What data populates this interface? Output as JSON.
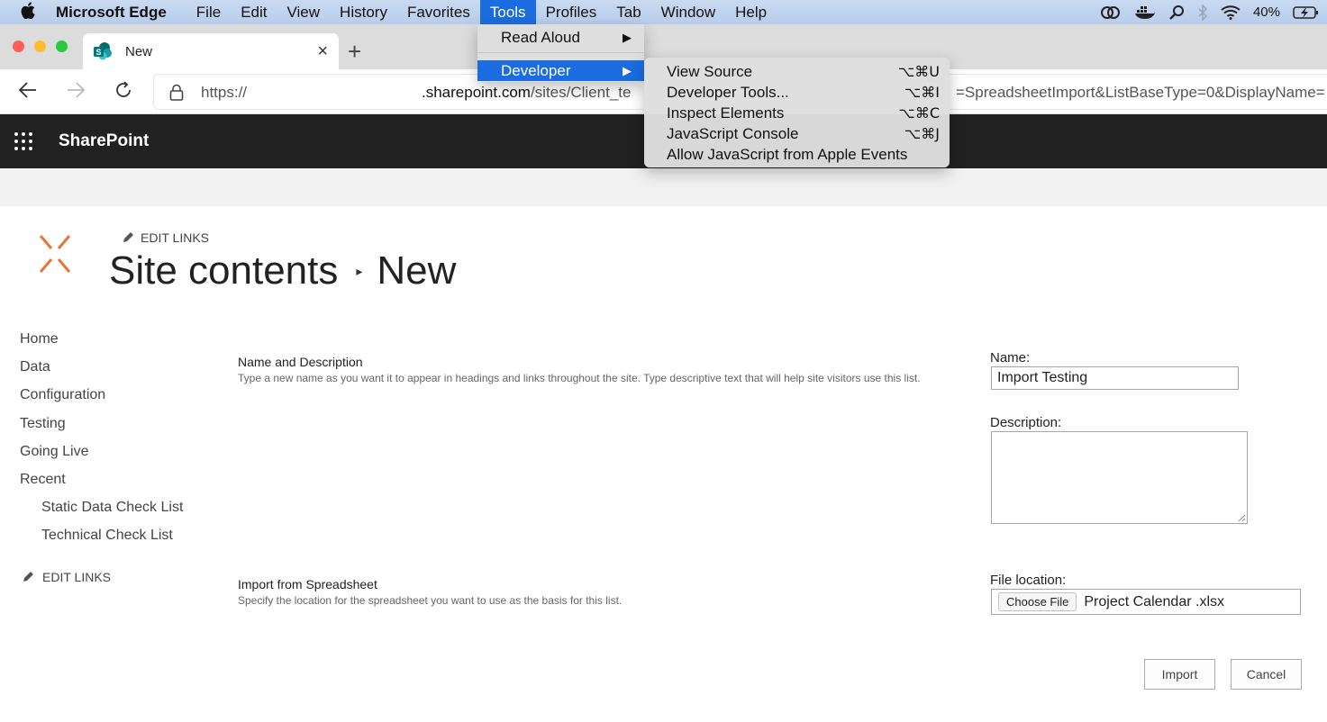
{
  "menubar": {
    "app_name": "Microsoft Edge",
    "items": [
      "File",
      "Edit",
      "View",
      "History",
      "Favorites",
      "Tools",
      "Profiles",
      "Tab",
      "Window",
      "Help"
    ],
    "active_item": "Tools",
    "battery": "40%"
  },
  "tools_menu": {
    "items": [
      {
        "label": "Read Aloud",
        "submenu": true
      },
      {
        "label": "Developer",
        "submenu": true,
        "highlighted": true
      }
    ]
  },
  "developer_menu": {
    "items": [
      {
        "label": "View Source",
        "shortcut": "⌥⌘U"
      },
      {
        "label": "Developer Tools...",
        "shortcut": "⌥⌘I"
      },
      {
        "label": "Inspect Elements",
        "shortcut": "⌥⌘C"
      },
      {
        "label": "JavaScript Console",
        "shortcut": "⌥⌘J"
      },
      {
        "label": "Allow JavaScript from Apple Events",
        "shortcut": ""
      }
    ]
  },
  "browser": {
    "tab_title": "New",
    "url_prefix": "https://",
    "url_domain": ".sharepoint.com",
    "url_path": "/sites/Client_te",
    "url_tail": "=SpreadsheetImport&ListBaseType=0&DisplayName="
  },
  "suite_bar": {
    "title": "SharePoint"
  },
  "page": {
    "edit_links": "EDIT LINKS",
    "breadcrumb_parent": "Site contents",
    "breadcrumb_current": "New"
  },
  "left_nav": {
    "items": [
      {
        "label": "Home",
        "level": 0
      },
      {
        "label": "Data",
        "level": 0
      },
      {
        "label": "Configuration",
        "level": 0
      },
      {
        "label": "Testing",
        "level": 0
      },
      {
        "label": "Going Live",
        "level": 0
      },
      {
        "label": "Recent",
        "level": 0
      },
      {
        "label": "Static Data Check List",
        "level": 1
      },
      {
        "label": "Technical Check List",
        "level": 1
      }
    ],
    "edit_links": "EDIT LINKS"
  },
  "form": {
    "name_section": {
      "title": "Name and Description",
      "description": "Type a new name as you want it to appear in headings and links throughout the site. Type descriptive text that will help site visitors use this list."
    },
    "name_label": "Name:",
    "name_value": "Import Testing",
    "description_label": "Description:",
    "description_value": "",
    "import_section": {
      "title": "Import from Spreadsheet",
      "description": "Specify the location for the spreadsheet you want to use as the basis for this list."
    },
    "file_label": "File location:",
    "choose_file_label": "Choose File",
    "file_name": "Project Calendar .xlsx",
    "import_button": "Import",
    "cancel_button": "Cancel"
  },
  "colors": {
    "menubar": "#c9daf1",
    "menu_highlight": "#1b6ce0",
    "suite_bar": "#212121",
    "logo_orange": "#e8743b"
  }
}
